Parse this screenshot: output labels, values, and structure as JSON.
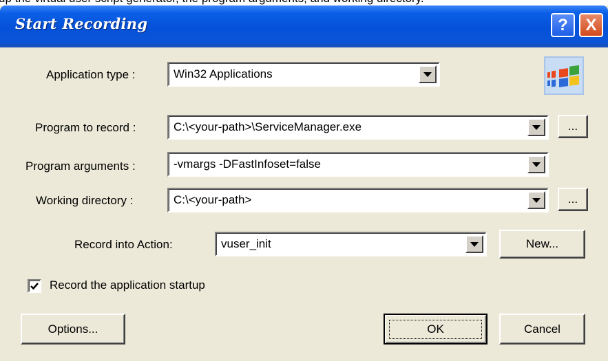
{
  "top_strip_text": "up the virtual user script generator, the program arguments, and working directory.",
  "title": "Start Recording",
  "title_buttons": {
    "help": "?",
    "close": "X"
  },
  "fields": {
    "application_type": {
      "label": "Application type :",
      "value": "Win32 Applications"
    },
    "program_to_record": {
      "label": "Program to record :",
      "value": "C:\\<your-path>\\ServiceManager.exe"
    },
    "program_arguments": {
      "label": "Program arguments :",
      "value": "-vmargs -DFastInfoset=false"
    },
    "working_directory": {
      "label": "Working directory :",
      "value": "C:\\<your-path>"
    },
    "record_into_action": {
      "label": "Record into Action:",
      "value": "vuser_init"
    }
  },
  "browse_label": "...",
  "new_label": "New...",
  "record_startup": {
    "label": "Record the application startup",
    "checked": true
  },
  "buttons": {
    "options": "Options...",
    "ok": "OK",
    "cancel": "Cancel"
  },
  "colors": {
    "titlebar": "#0551d8",
    "dialog_bg": "#ece9d8",
    "close": "#d24a1d"
  }
}
